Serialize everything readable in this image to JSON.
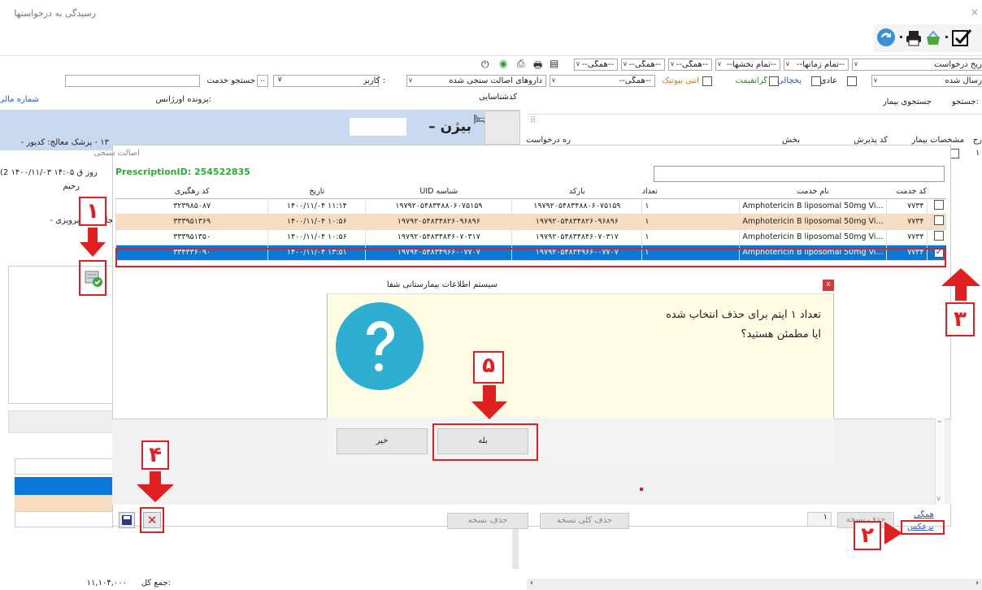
{
  "window": {
    "title": "رسیدگی به درخواستها",
    "close": "×"
  },
  "filters_row1": {
    "request_date": "ریخ درخواست",
    "all_times": "--تمام زمانها--",
    "all_wards": "--تمام بخشها--",
    "all1": "--همگی--",
    "all2": "--همگی--",
    "all3": "--همگی--"
  },
  "filters_row2": {
    "sent": "رسال شده",
    "normal": "عادی",
    "refrigerator": "یخچالی",
    "expensive": "گرانقیمت",
    "antibiotic": "آنتی بیوتیک",
    "all": "--همگی--",
    "authenticity_drugs": "داروهای اصالت سنجی شده",
    "user_label": ": کاربر",
    "service_search_label": "جستجو خدمت",
    "service_btn": ".."
  },
  "left_panel": {
    "financial_no": "شماره مالی",
    "emergency_file": ":پرونده اورژانس",
    "expert_code": "کدشناسایی",
    "patient_name": "بیژن –",
    "info_line": "۱۳ - پزشک معالج: کدیور -",
    "time_text": "(2 روز ق  ۱۴:۰۵ ۱۴۰۰/۱۱/۰۳",
    "raheem": "رحیم",
    "creator": "یجادکننده: پرویزی -",
    "total_label": ":جمع کل",
    "total_value": "۱۱,۱۰۴,۰۰۰"
  },
  "right_panel": {
    "search_label": ":جستجو",
    "search_value": "جستجوی بیمار",
    "col_rej": "رج",
    "col_patient": "مشخصات بیمار",
    "col_admit": "کد پذیرش",
    "col_ward": "بخش",
    "col_req": "ره درخواست",
    "row_num": "۱"
  },
  "dialog": {
    "title": "اصالت سنجی",
    "prescription": "PrescriptionID: 254522835",
    "columns": [
      "کد خدمت",
      "نام خدمت",
      "تعداد",
      "بارکد",
      "شناسه UID",
      "تاریخ",
      "کد رهگیری"
    ],
    "rows": [
      {
        "code": "۷۷۳۴",
        "name": "Amphotericin B liposomal 50mg Vi...",
        "count": "۱",
        "barcode": "۱۹۷۹۲۰۵۴۸۳۴۸۸۰۶۰۷۵۱۵۹",
        "uid": "۱۹۷۹۲۰۵۴۸۳۴۸۸۰۶۰۷۵۱۵۹",
        "date": "۱۱:۱۴ ۱۴۰۰/۱۱/۰۴",
        "track": "۳۲۳۹۸۵۰۸۷",
        "checked": false
      },
      {
        "code": "۷۷۳۴",
        "name": "Amphotericin B liposomal 50mg Vi...",
        "count": "۱",
        "barcode": "۱۹۷۹۲۰۵۴۸۳۴۸۲۶۰۹۶۸۹۶",
        "uid": "۱۹۷۹۲۰۵۴۸۳۴۸۲۶۰۹۶۸۹۶",
        "date": "۱۰:۵۶ ۱۴۰۰/۱۱/۰۴",
        "track": "۳۳۳۹۵۱۳۶۹",
        "checked": false
      },
      {
        "code": "۷۷۳۴",
        "name": "Amphotericin B liposomal 50mg Vi...",
        "count": "۱",
        "barcode": "۱۹۷۹۲۰۵۴۸۳۴۸۴۶۰۷۰۳۱۷",
        "uid": "۱۹۷۹۲۰۵۴۸۳۴۸۴۶۰۷۰۳۱۷",
        "date": "۱۰:۵۶ ۱۴۰۰/۱۱/۰۴",
        "track": "۳۳۳۹۵۱۳۵۰",
        "checked": false
      },
      {
        "code": "۷۷۳۴",
        "name": "Amphotericin B liposomal 50mg Vi...",
        "count": "۱",
        "barcode": "۱۹۷۹۲۰۵۴۸۳۴۹۶۶۰۰۷۷۰۷",
        "uid": "۱۹۷۹۲۰۵۴۸۳۴۹۶۶۰۰۷۷۰۷",
        "date": "۱۳:۵۱ ۱۴۰۰/۱۱/۰۴",
        "track": "۳۳۴۳۳۶۰۹۰",
        "checked": true
      }
    ]
  },
  "confirm": {
    "title": "سیستم اطلاعات بیمارستانی شفا",
    "close": "x",
    "line1": "تعداد ۱ آیتم برای حذف انتخاب شده",
    "line2": "آیا مطمئن هستید؟",
    "yes": "بله",
    "no": "خیر"
  },
  "bottom": {
    "delete_all_copy": "حذف کلی نسخه",
    "delete_copy": "حذف نسخه",
    "delete_copy2": "حذف نسخه",
    "count_value": "۱",
    "all_link": "همگی",
    "invert_link": "برعکس"
  },
  "annotations": {
    "n1": "۱",
    "n2": "۲",
    "n3": "۳",
    "n4": "۴",
    "n5": "۵"
  },
  "colors": {
    "accent_red": "#e02020",
    "selected_row": "#0a78d7",
    "peach_row": "#f8dcc0",
    "dialog_bg": "#fefde3",
    "help_icon": "#2eaed0"
  }
}
